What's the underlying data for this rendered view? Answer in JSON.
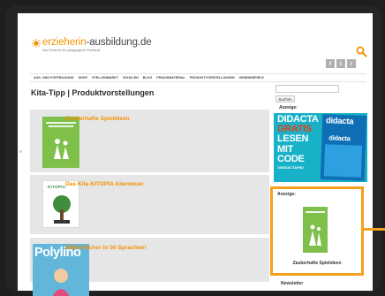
{
  "header": {
    "logo_part1": "erzieherin",
    "logo_part2": "-ausbildung.de",
    "tagline": "Das Portal für die pädagogische Fachkraft",
    "social": [
      "f",
      "t",
      "r"
    ]
  },
  "nav": {
    "items": [
      "AUS- UND FORTBILDUNG",
      "SHOP",
      "STELLENMARKT",
      "SCHULEN",
      "BLOG",
      "PRAXISMATERIAL",
      "PRODUKTVORSTELLUNGEN",
      "GEWINNSPIELE"
    ]
  },
  "page": {
    "title": "Kita-Tipp | Produktvorstellungen"
  },
  "products": [
    {
      "title": "Zauberhafte Spielideen"
    },
    {
      "title": "Das Kita KITOPIA Abenteuer",
      "cover_text": "KITOPIA"
    },
    {
      "title": "Bilderbücher in 50 Sprachen!",
      "cover_text": "Polylino"
    }
  ],
  "sidebar": {
    "search_button": "Suchen",
    "ad_label_1": "Anzeige:",
    "ad": {
      "brand": "DIDACTA",
      "line1": "GRATIS",
      "line2": "LESEN",
      "line3": "MIT CODE",
      "code": "19DIDACTAFB0",
      "magazine_title": "didacta",
      "magazine_title2": "didacta"
    },
    "ad_label_2": "Anzeige:",
    "featured_caption": "Zauberhafte Spielideen",
    "newsletter_label": "Newsletter"
  },
  "colors": {
    "brand_orange": "#f39200",
    "highlight": "#f5a01d",
    "ad_teal": "#17b2c7",
    "cover_green": "#7fc04b"
  }
}
